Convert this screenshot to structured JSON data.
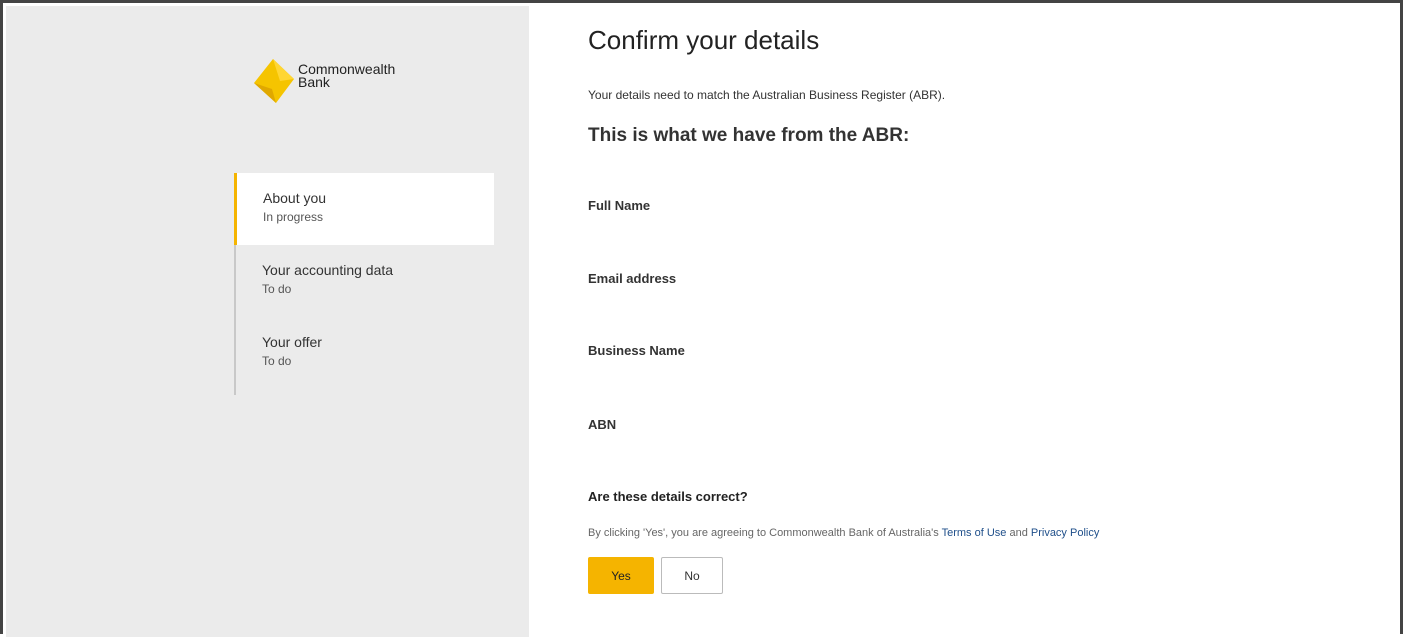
{
  "brand": {
    "line1": "Commonwealth",
    "line2": "Bank",
    "accent_color": "#f5b400",
    "icon": "diamond-logo-icon"
  },
  "sidebar": {
    "steps": [
      {
        "title": "About you",
        "status": "In progress",
        "active": true
      },
      {
        "title": "Your accounting data",
        "status": "To do",
        "active": false
      },
      {
        "title": "Your offer",
        "status": "To do",
        "active": false
      }
    ]
  },
  "main": {
    "title": "Confirm your details",
    "intro": "Your details need to match the Australian Business Register (ABR).",
    "subheading": "This is what we have from the ABR:",
    "fields": {
      "full_name": "Full Name",
      "email": "Email address",
      "business_name": "Business Name",
      "abn": "ABN"
    },
    "question": "Are these details correct?",
    "consent": {
      "prefix": "By clicking 'Yes', you are agreeing to Commonwealth Bank of Australia's ",
      "terms_link": "Terms of Use",
      "middle": " and ",
      "privacy_link": "Privacy Policy"
    },
    "buttons": {
      "yes": "Yes",
      "no": "No"
    }
  }
}
